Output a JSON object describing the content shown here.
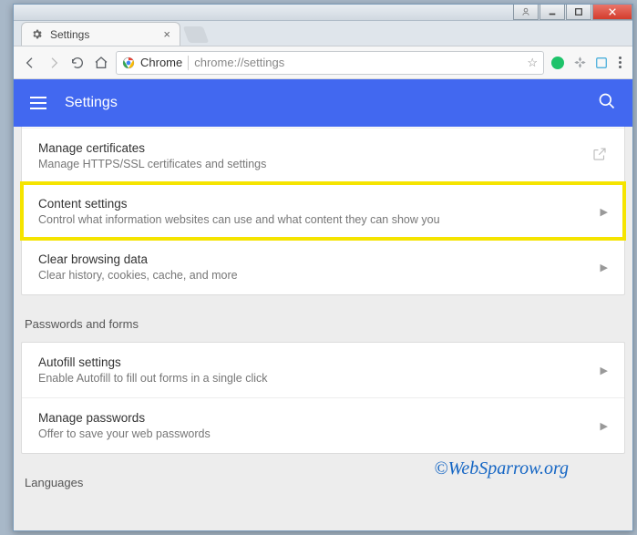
{
  "window": {
    "tab_title": "Settings"
  },
  "toolbar": {
    "origin_label": "Chrome",
    "url": "chrome://settings"
  },
  "header": {
    "title": "Settings"
  },
  "sections": {
    "top_card": {
      "rows": [
        {
          "title": "Manage certificates",
          "subtitle": "Manage HTTPS/SSL certificates and settings",
          "type": "external"
        },
        {
          "title": "Content settings",
          "subtitle": "Control what information websites can use and what content they can show you",
          "type": "arrow",
          "highlighted": true
        },
        {
          "title": "Clear browsing data",
          "subtitle": "Clear history, cookies, cache, and more",
          "type": "arrow"
        }
      ]
    },
    "passwords": {
      "heading": "Passwords and forms",
      "rows": [
        {
          "title": "Autofill settings",
          "subtitle": "Enable Autofill to fill out forms in a single click",
          "type": "arrow"
        },
        {
          "title": "Manage passwords",
          "subtitle": "Offer to save your web passwords",
          "type": "arrow"
        }
      ]
    },
    "languages": {
      "heading": "Languages"
    }
  },
  "watermark": "©WebSparrow.org"
}
